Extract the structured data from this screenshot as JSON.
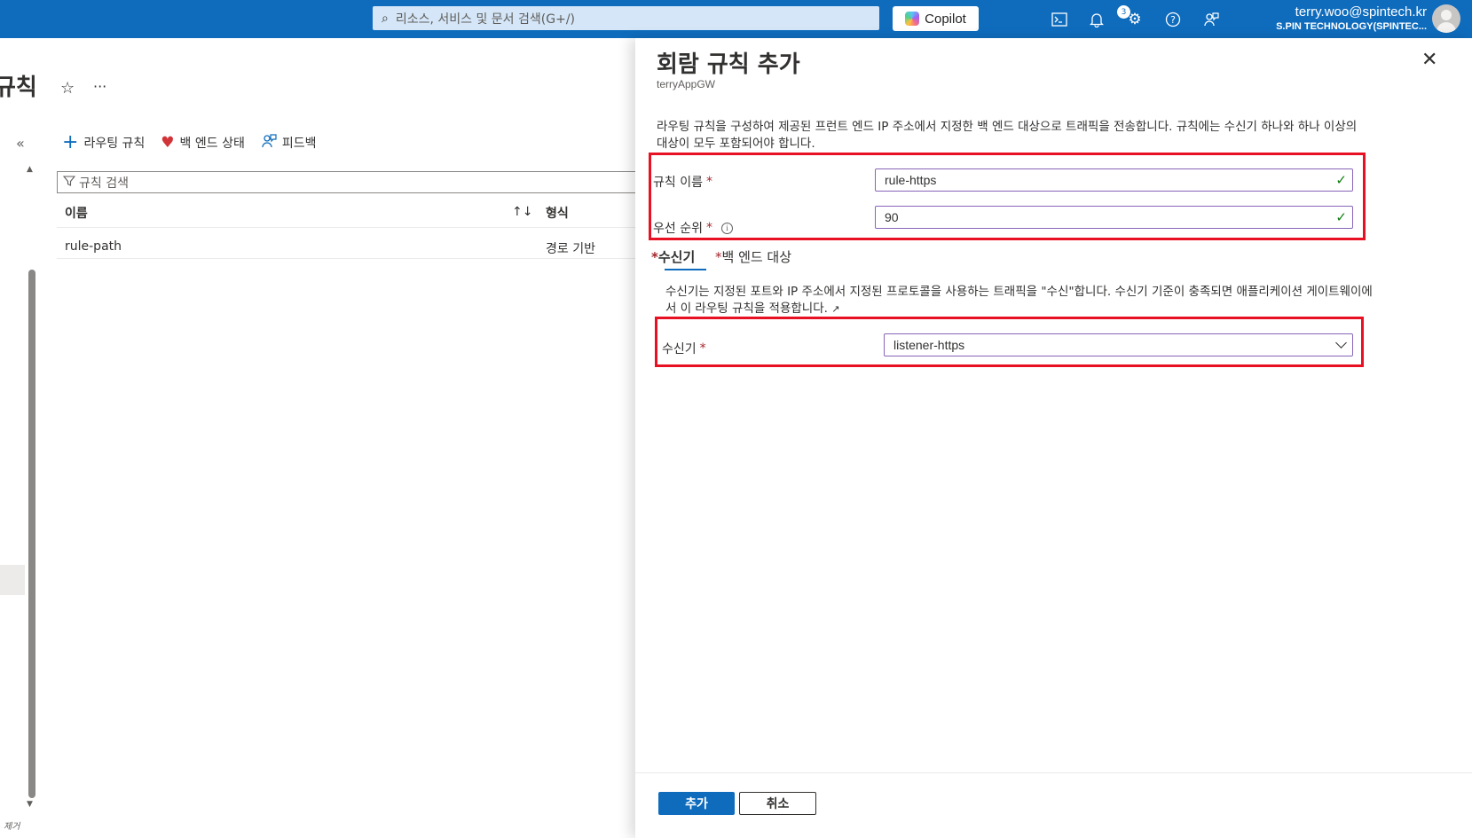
{
  "topbar": {
    "search_placeholder": "리소스, 서비스 및 문서 검색(G+/)",
    "copilot_label": "Copilot",
    "notification_count": "3",
    "user_email": "terry.woo@spintech.kr",
    "user_org": "S.PIN TECHNOLOGY(SPINTEC..."
  },
  "background": {
    "page_title": "규칙",
    "collapse": "«",
    "commands": {
      "add_routing_rule": "라우팅 규칙",
      "backend_health": "백 엔드 상태",
      "feedback": "피드백"
    },
    "filter_placeholder": "규칙 검색",
    "table": {
      "columns": [
        "이름",
        "형식"
      ],
      "rows": [
        {
          "name": "rule-path",
          "type": "경로 기반"
        }
      ]
    },
    "remove_label": "제거"
  },
  "panel": {
    "title": "회람 규칙 추가",
    "subtitle": "terryAppGW",
    "description": "라우팅 규칙을 구성하여 제공된 프런트 엔드 IP 주소에서 지정한 백 엔드 대상으로 트래픽을 전송합니다. 규칙에는 수신기 하나와 하나 이상의 대상이 모두 포함되어야 합니다.",
    "rule_name_label": "규칙 이름",
    "rule_name_value": "rule-https",
    "priority_label": "우선 순위",
    "priority_value": "90",
    "tabs": [
      "수신기",
      "백 엔드 대상"
    ],
    "listener_description": "수신기는 지정된 포트와 IP 주소에서 지정된 프로토콜을 사용하는 트래픽을 \"수신\"합니다. 수신기 기준이 충족되면 애플리케이션 게이트웨이에서 이 라우팅 규칙을 적용합니다.",
    "listener_label": "수신기",
    "listener_value": "listener-https",
    "add_button": "추가",
    "cancel_button": "취소"
  },
  "colors": {
    "accent": "#0f6cbd",
    "highlight": "#e81123",
    "valid": "#107c10",
    "required": "#a4262c"
  }
}
